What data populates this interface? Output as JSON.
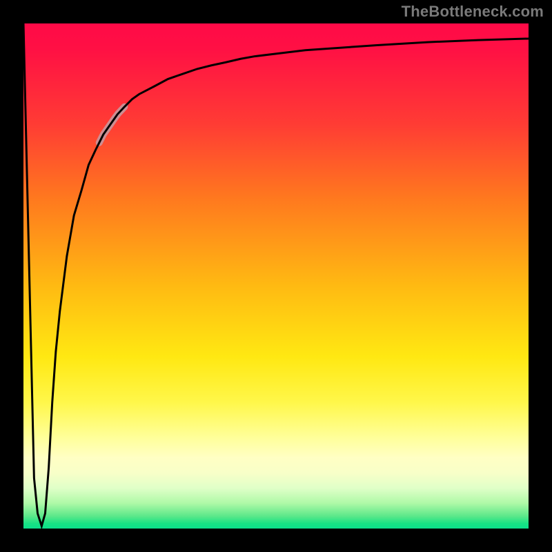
{
  "watermark": "TheBottleneck.com",
  "chart_data": {
    "type": "line",
    "title": "",
    "xlabel": "",
    "ylabel": "",
    "xlim": [
      0,
      100
    ],
    "ylim": [
      0,
      100
    ],
    "grid": false,
    "legend": false,
    "x": [
      0,
      0.7,
      1.4,
      2.1,
      2.8,
      3.6,
      4.3,
      5,
      5.7,
      6.4,
      7.2,
      8.6,
      10,
      11.5,
      12.9,
      14.3,
      15.8,
      17.2,
      18.6,
      20,
      21.5,
      22.9,
      25.8,
      28.6,
      31.5,
      34.4,
      37.2,
      40,
      43,
      45.8,
      50,
      55.8,
      60,
      70,
      80,
      90,
      100
    ],
    "values": [
      100,
      70,
      40,
      10,
      3,
      0.5,
      3,
      12,
      25,
      35,
      43,
      54,
      62,
      67,
      72,
      75,
      78,
      80,
      82,
      83.5,
      85,
      86,
      87.5,
      89,
      90,
      91,
      91.7,
      92.3,
      93,
      93.5,
      94,
      94.7,
      95,
      95.7,
      96.3,
      96.7,
      97
    ],
    "highlight_segment": {
      "x_start": 15,
      "x_end": 20,
      "color": "#cd8e93",
      "width": 10
    },
    "background_gradient": {
      "stops": [
        {
          "pos": 0,
          "color": "#ff0a47"
        },
        {
          "pos": 35,
          "color": "#ff7a1e"
        },
        {
          "pos": 66,
          "color": "#ffe812"
        },
        {
          "pos": 86,
          "color": "#ffffc4"
        },
        {
          "pos": 95,
          "color": "#aef9a7"
        },
        {
          "pos": 100,
          "color": "#0be08a"
        }
      ]
    }
  }
}
